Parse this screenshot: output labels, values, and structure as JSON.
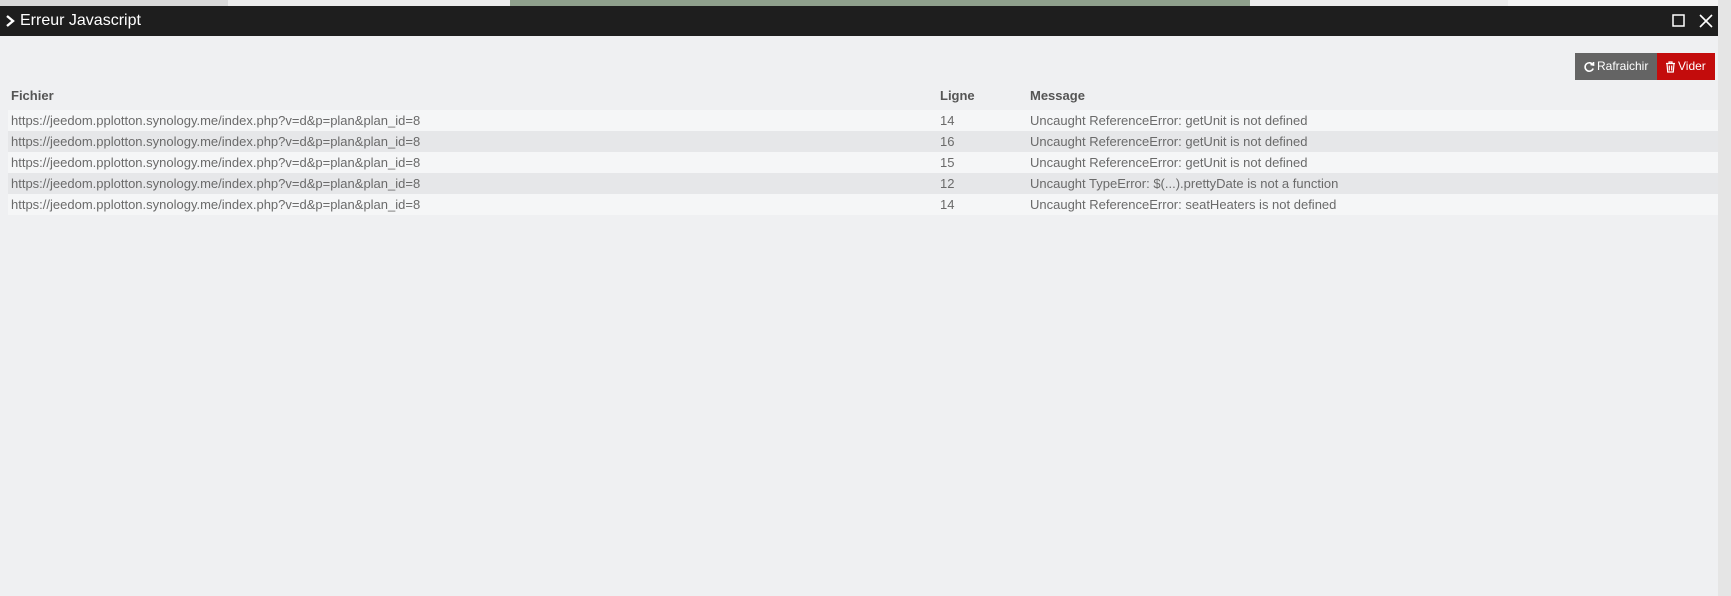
{
  "dialog": {
    "title": "Erreur Javascript"
  },
  "toolbar": {
    "refresh_label": "Rafraichir",
    "clear_label": "Vider"
  },
  "table": {
    "headers": {
      "file": "Fichier",
      "line": "Ligne",
      "message": "Message"
    },
    "rows": [
      {
        "file": "https://jeedom.pplotton.synology.me/index.php?v=d&p=plan&plan_id=8",
        "line": "14",
        "message": "Uncaught ReferenceError: getUnit is not defined"
      },
      {
        "file": "https://jeedom.pplotton.synology.me/index.php?v=d&p=plan&plan_id=8",
        "line": "16",
        "message": "Uncaught ReferenceError: getUnit is not defined"
      },
      {
        "file": "https://jeedom.pplotton.synology.me/index.php?v=d&p=plan&plan_id=8",
        "line": "15",
        "message": "Uncaught ReferenceError: getUnit is not defined"
      },
      {
        "file": "https://jeedom.pplotton.synology.me/index.php?v=d&p=plan&plan_id=8",
        "line": "12",
        "message": "Uncaught TypeError: $(...).prettyDate is not a function"
      },
      {
        "file": "https://jeedom.pplotton.synology.me/index.php?v=d&p=plan&plan_id=8",
        "line": "14",
        "message": "Uncaught ReferenceError: seatHeaters is not defined"
      }
    ]
  },
  "colors": {
    "titlebar": "#1e1e1e",
    "refresh_button": "#646464",
    "clear_button": "#c30c0c",
    "body": "#eff0f2"
  },
  "icons": {
    "expand": "chevron-right-icon",
    "maximize": "maximize-icon",
    "close": "close-icon",
    "refresh": "refresh-icon",
    "clear": "trash-icon"
  }
}
